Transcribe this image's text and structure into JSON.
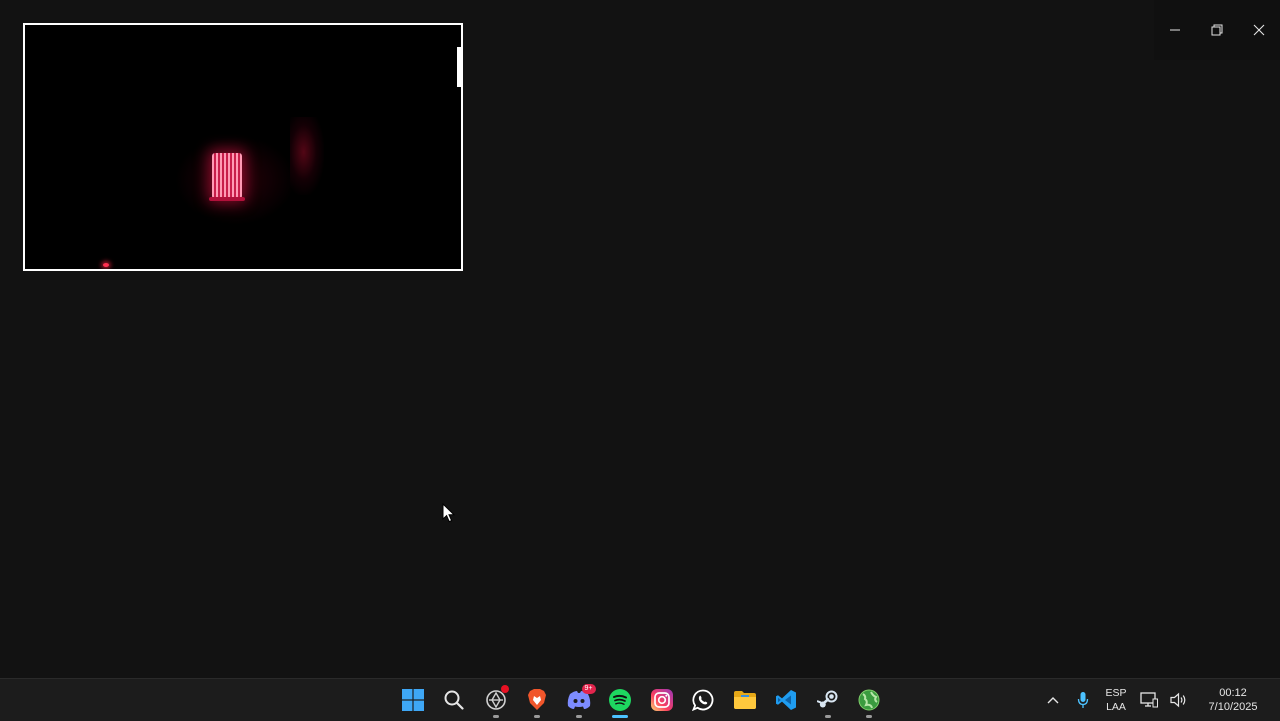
{
  "window": {
    "controls": {
      "minimize": "minimize-icon",
      "restore": "restore-icon",
      "close": "close-icon"
    }
  },
  "preview": {
    "description_icon": "camera-feed",
    "border_color": "#ffffff"
  },
  "taskbar": {
    "apps": [
      {
        "name": "start",
        "icon": "windows-logo-icon"
      },
      {
        "name": "search",
        "icon": "search-icon"
      },
      {
        "name": "chatgpt",
        "icon": "openai-icon",
        "badge_dot": true
      },
      {
        "name": "brave",
        "icon": "brave-lion-icon"
      },
      {
        "name": "discord",
        "icon": "discord-icon",
        "badge": "9+"
      },
      {
        "name": "spotify",
        "icon": "spotify-icon",
        "active": true
      },
      {
        "name": "instagram",
        "icon": "instagram-icon"
      },
      {
        "name": "whatsapp",
        "icon": "whatsapp-icon"
      },
      {
        "name": "file-explorer",
        "icon": "folder-icon"
      },
      {
        "name": "vscode",
        "icon": "vscode-icon"
      },
      {
        "name": "steam",
        "icon": "steam-icon"
      },
      {
        "name": "globe-app",
        "icon": "globe-icon"
      }
    ],
    "tray": {
      "language_line1": "ESP",
      "language_line2": "LAA",
      "time": "00:12",
      "date": "7/10/2025"
    },
    "accent": "#4cc2ff"
  }
}
